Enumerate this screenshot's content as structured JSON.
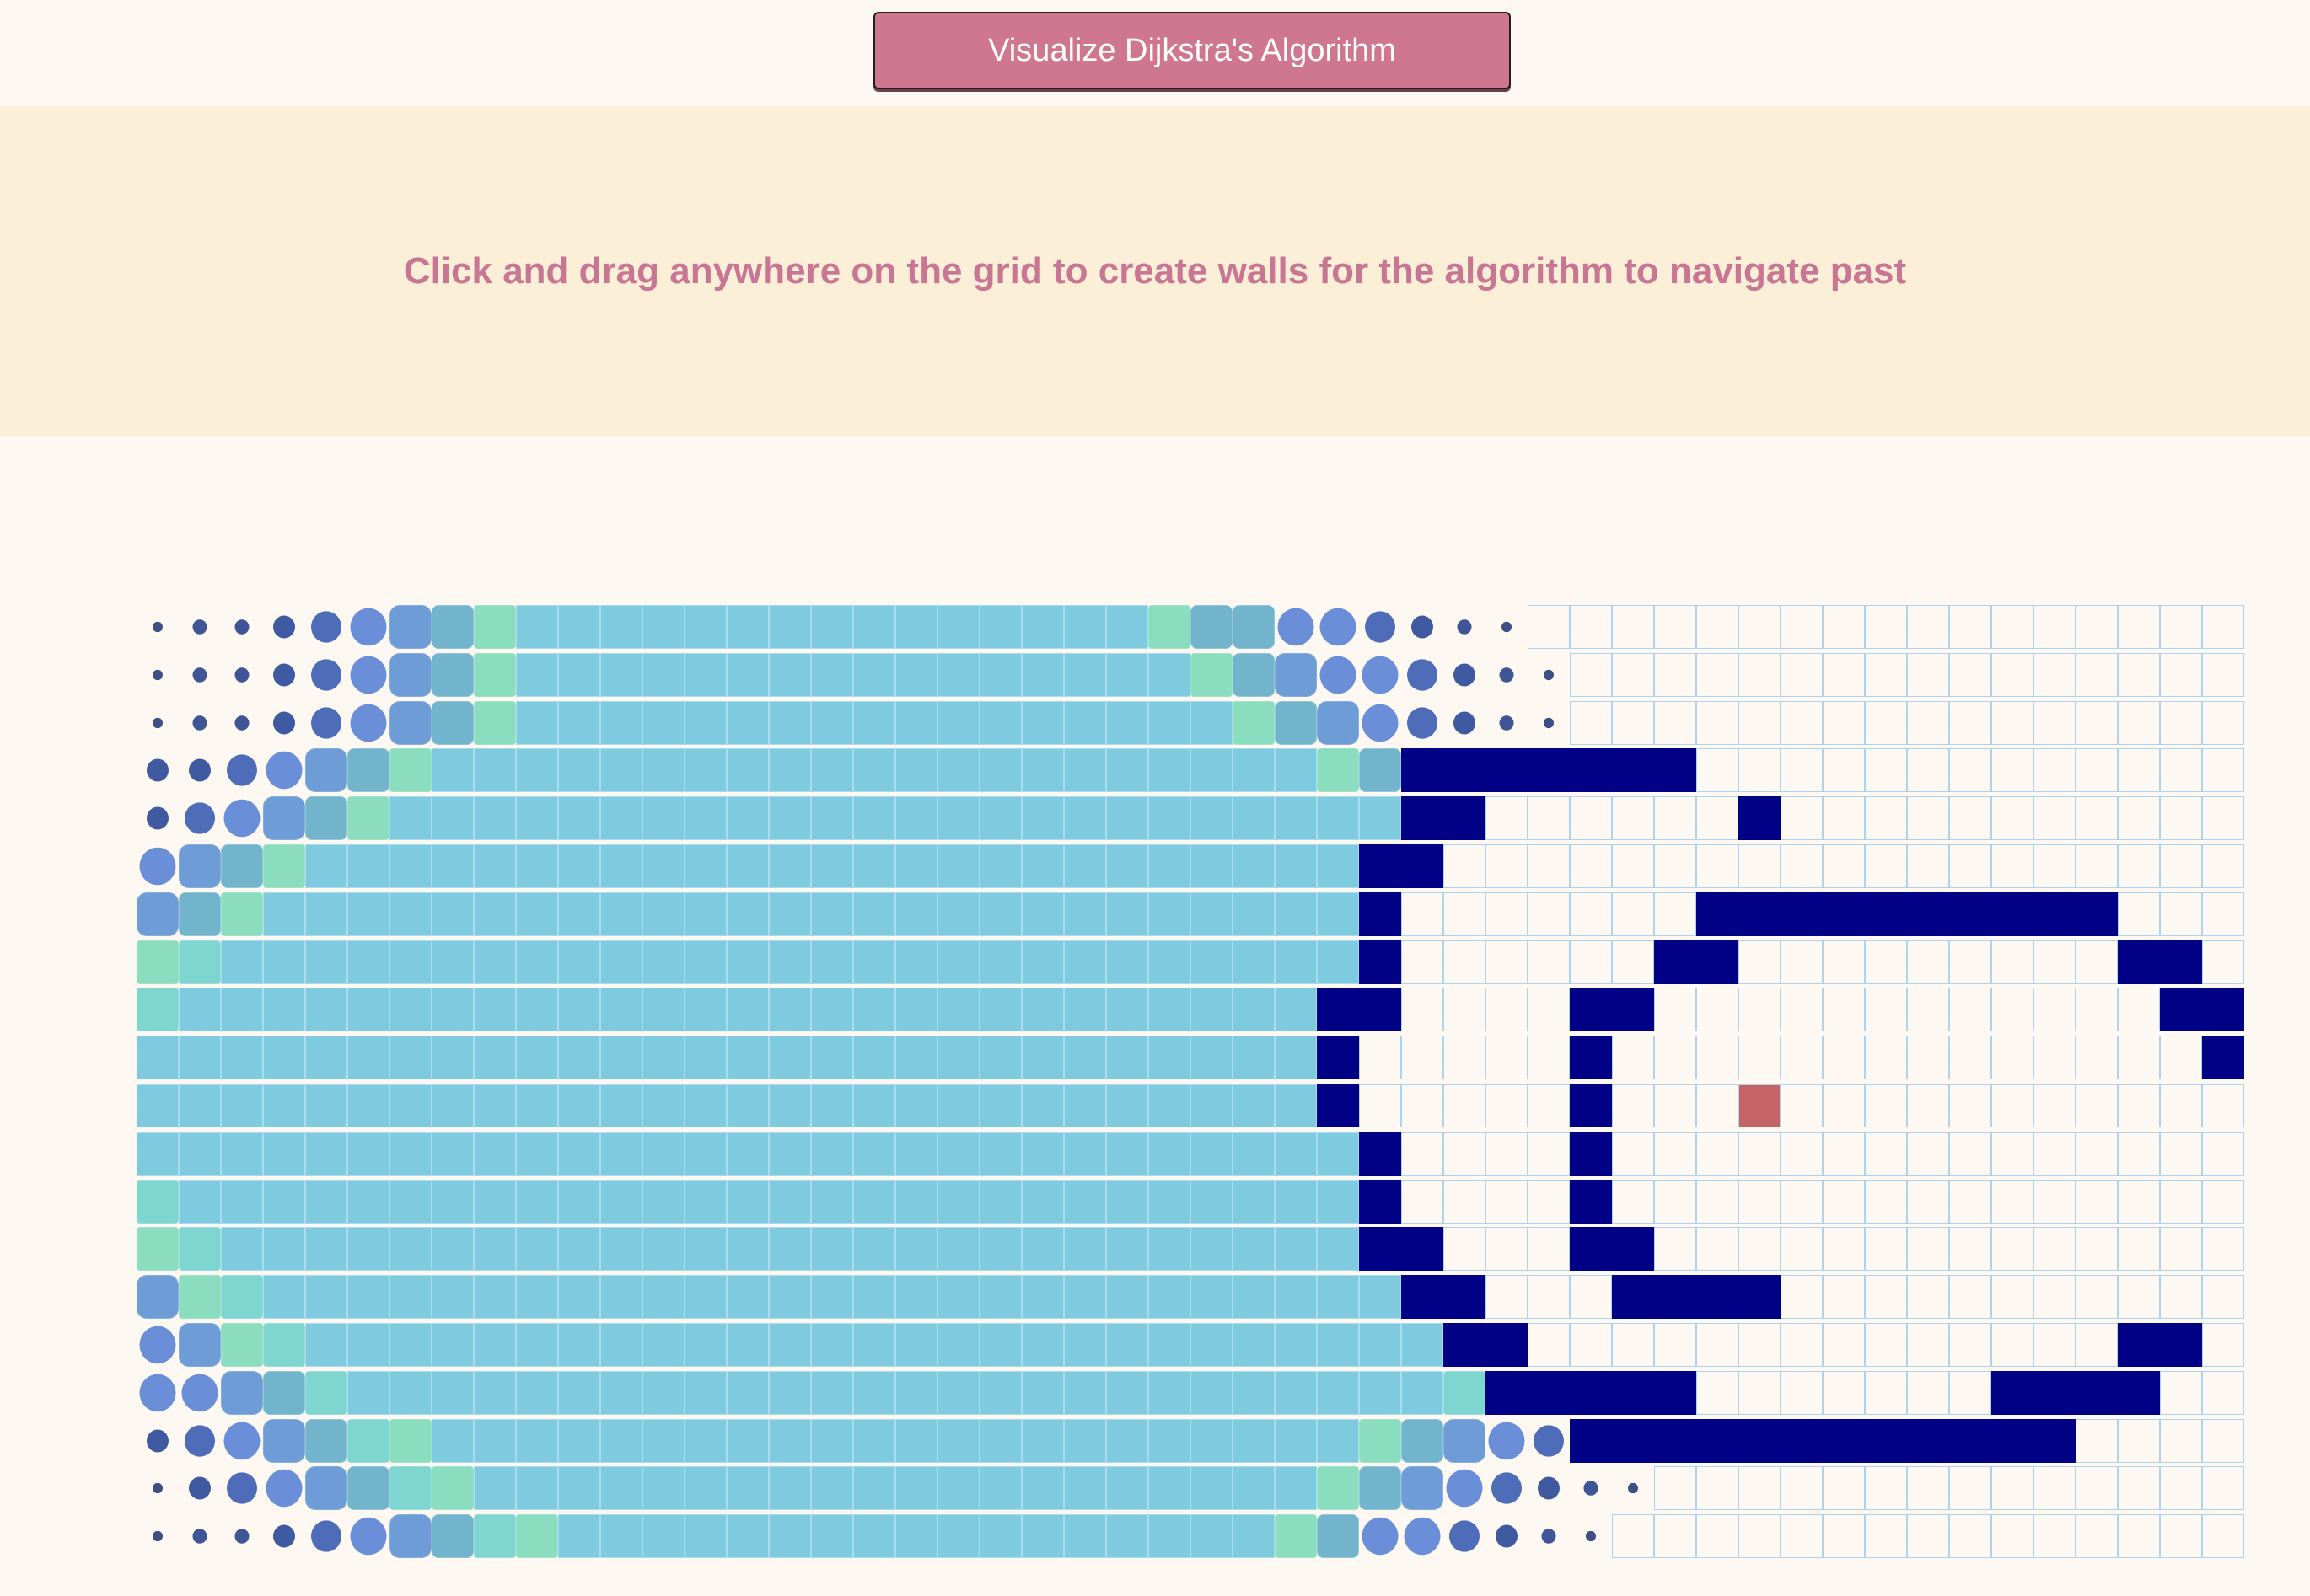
{
  "header": {
    "visualize_button_label": "Visualize Dijkstra's Algorithm"
  },
  "instructions": {
    "text": "Click and drag anywhere on the grid to create walls for the algorithm to navigate past"
  },
  "colors": {
    "page_background": "#fdf8f1",
    "banner_background": "#fcefd8",
    "accent": "#cf7790",
    "instruction_text": "#c97594",
    "wall": "#010186",
    "target": "#c46466",
    "visited": "#7ecadf",
    "visited_frontier_green": "#8addbf",
    "visited_frontier_blue": "#6a8ed7",
    "cell_border": "#aed3ee"
  },
  "grid": {
    "rows": 20,
    "cols": 50,
    "legend": {
      "e": "visited",
      "a": "visited-green",
      "b": "visited-teal",
      "c": "visited-steel",
      "d": "visited-blue-rounded",
      "f": "frontier-large",
      "g": "frontier-medium",
      "h": "frontier-small",
      "i": "frontier-tiny",
      "j": "frontier-dot",
      "W": "wall",
      "T": "target",
      ".": "empty"
    },
    "layout_rows": [
      "jiihgfdcaeeeeeeeeeeeeeeeaccffghij..................",
      "jiihgfdcaeeeeeeeeeeeeeeeeacdffghij.................",
      "jiihgfdcaeeeeeeeeeeeeeeeeeacdfghij.................",
      "hhgfdcaeeeeeeeeeeeeeeeeeeeeeacWWWWWWW..............",
      "hgfdcaeeeeeeeeeeeeeeeeeeeeeeeeWW......W............",
      "fdcaeeeeeeeeeeeeeeeeeeeeeeeeeWW....................",
      "dcaeeeeeeeeeeeeeeeeeeeeeeeeeeW.......WWWWWWWWWW....",
      "abeeeeeeeeeeeeeeeeeeeeeeeeeeeW......WW.........WW..",
      "beeeeeeeeeeeeeeeeeeeeeeeeeeeWW....WW............WW.",
      "eeeeeeeeeeeeeeeeeeeeeeeeeeeeW.....W..............W.",
      "eeeeeeeeeeeeeeeeeeeeeeeeeeeeW.....W...T...........W",
      "eeeeeeeeeeeeeeeeeeeeeeeeeeeeeW....W...............W",
      "beeeeeeeeeeeeeeeeeeeeeeeeeeeeW....W...............W",
      "abeeeeeeeeeeeeeeeeeeeeeeeeeeeWW...WW..............W",
      "dabeeeeeeeeeeeeeeeeeeeeeeeeeeeWW...WWWW...........W",
      "fdabeeeeeeeeeeeeeeeeeeeeeeeeeeeWW..............WW..",
      "ffdcbeeeeeeeeeeeeeeeeeeeeeeeeeebWWWWW.......WWWW...",
      "hgfdcbaeeeeeeeeeeeeeeeeeeeeeeacdfgWWWWWWWWWWWW.....",
      "jhgfdcbaeeeeeeeeeeeeeeeeeeeeacdfghij...............",
      "jiihgfdcbaeeeeeeeeeeeeeeeeeacffghij................"
    ]
  }
}
